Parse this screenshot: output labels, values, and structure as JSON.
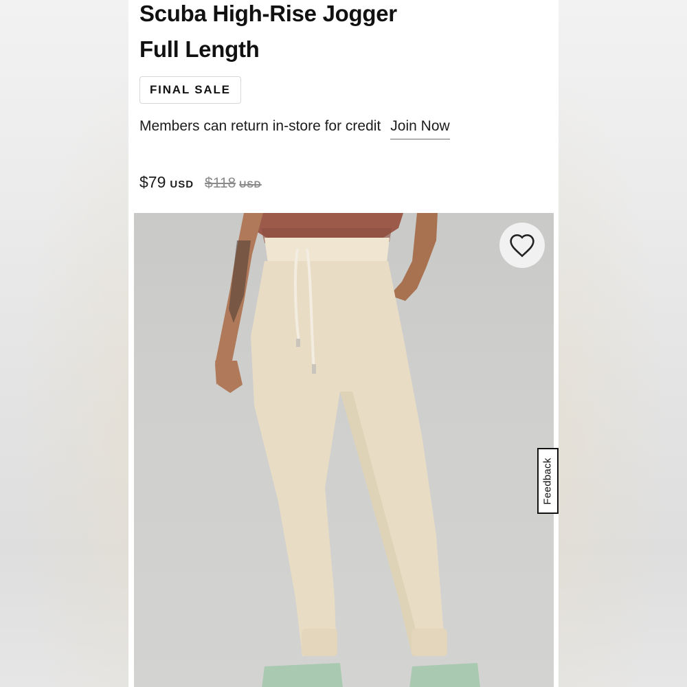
{
  "product": {
    "title_line1": "Scuba High-Rise Jogger",
    "title_line2": "Full Length",
    "badge": "FINAL SALE",
    "member_text": "Members can return in-store for credit",
    "join_link": "Join Now",
    "price": {
      "current_amount": "$79",
      "current_currency": "USD",
      "original_amount": "$118",
      "original_currency": "USD"
    }
  },
  "image": {
    "wishlist_icon": "heart-outline-icon",
    "description_colors": {
      "background": "#cdcdcb",
      "pants": "#e8dcc4",
      "top": "#9c5a4a",
      "slides": "#a9c9b0"
    }
  },
  "feedback": {
    "label": "Feedback"
  }
}
